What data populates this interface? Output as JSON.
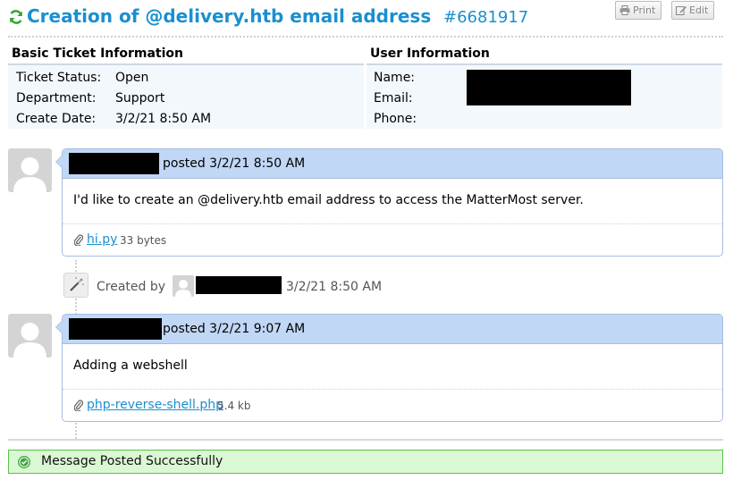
{
  "ticket": {
    "title": "Creation of @delivery.htb email address",
    "number": "#6681917",
    "print_label": "Print",
    "edit_label": "Edit"
  },
  "basic_info": {
    "heading": "Basic Ticket Information",
    "rows": [
      {
        "label": "Ticket Status:",
        "value": "Open"
      },
      {
        "label": "Department:",
        "value": "Support"
      },
      {
        "label": "Create Date:",
        "value": "3/2/21 8:50 AM"
      }
    ]
  },
  "user_info": {
    "heading": "User Information",
    "rows": [
      {
        "label": "Name:"
      },
      {
        "label": "Email:"
      },
      {
        "label": "Phone:"
      }
    ]
  },
  "thread": [
    {
      "posted": "posted 3/2/21 8:50 AM",
      "body": "I'd like to create an @delivery.htb email address to access the MatterMost server.",
      "attachment": {
        "name": "hi.py",
        "size": "33 bytes"
      }
    },
    {
      "posted": "posted 3/2/21 9:07 AM",
      "body": "Adding a webshell",
      "attachment": {
        "name": "php-reverse-shell.php",
        "size": "5.4 kb"
      }
    }
  ],
  "event": {
    "created_by": "Created by",
    "time": "3/2/21 8:50 AM"
  },
  "alert": {
    "message": "Message Posted Successfully"
  },
  "colors": {
    "accent": "#1a8fd0",
    "refresh_icon": "#2fa32f",
    "entry_header_bg": "#c0d7f5",
    "success_bg": "#dbf8d4",
    "success_border": "#59c24a"
  },
  "icons": [
    "refresh-icon",
    "print-icon",
    "edit-icon",
    "paperclip-icon",
    "magic-wand-icon",
    "check-circle-icon",
    "avatar-icon"
  ]
}
